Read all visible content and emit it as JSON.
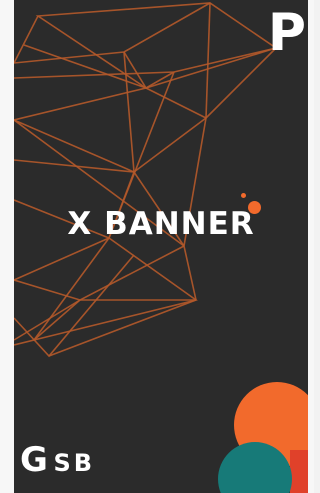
{
  "banner": {
    "title": "X BANNER",
    "corner_letter": "P",
    "brand_big": "G",
    "brand_small": "SB"
  },
  "colors": {
    "background": "#2b2b2b",
    "accent_orange": "#f26a2c",
    "line_orange": "#b4592a",
    "teal": "#177a78",
    "red": "#e0412a"
  },
  "icons": [
    "geometric-network-graphic",
    "decorative-circles"
  ]
}
